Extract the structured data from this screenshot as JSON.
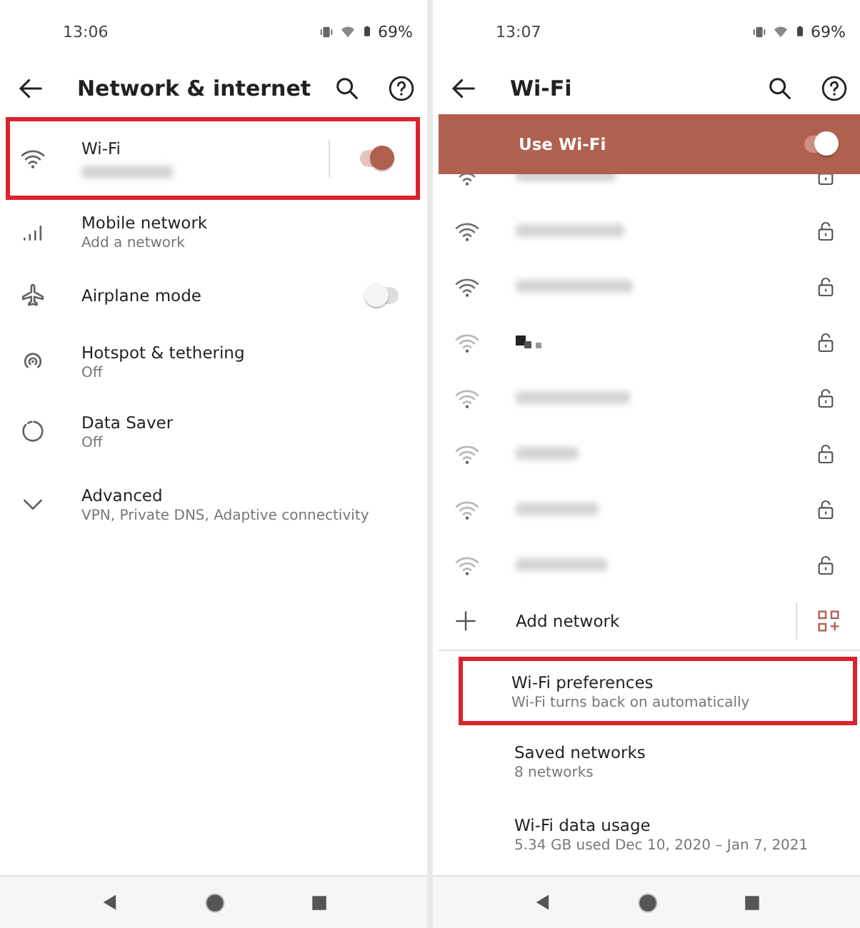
{
  "screens": [
    {
      "status_bar": {
        "time": "13:06",
        "battery": "69%"
      },
      "title": "Network & internet",
      "items": [
        {
          "kind": "toggle",
          "title": "Wi-Fi",
          "subtitle_redacted": true,
          "on": true,
          "highlighted": true
        },
        {
          "kind": "link",
          "title": "Mobile network",
          "subtitle": "Add a network",
          "highlighted": false
        },
        {
          "kind": "toggle",
          "title": "Airplane mode",
          "on": false,
          "highlighted": false
        },
        {
          "kind": "link",
          "title": "Hotspot & tethering",
          "subtitle": "Off",
          "highlighted": false
        },
        {
          "kind": "link",
          "title": "Data Saver",
          "subtitle": "Off",
          "highlighted": false
        },
        {
          "kind": "expand",
          "title": "Advanced",
          "subtitle": "VPN, Private DNS, Adaptive connectivity",
          "highlighted": false
        }
      ]
    },
    {
      "status_bar": {
        "time": "13:07",
        "battery": "69%"
      },
      "title": "Wi-Fi",
      "master_switch": {
        "label": "Use Wi-Fi",
        "on": true
      },
      "networks": [
        {
          "kind": "blurred",
          "locked": true
        },
        {
          "kind": "blurred",
          "locked": true
        },
        {
          "kind": "blurred",
          "locked": true
        },
        {
          "kind": "pixelated",
          "locked": true
        },
        {
          "kind": "blurred",
          "locked": true
        },
        {
          "kind": "blurred",
          "locked": true
        },
        {
          "kind": "blurred",
          "locked": true
        },
        {
          "kind": "blurred",
          "locked": true
        }
      ],
      "add_network": {
        "label": "Add network"
      },
      "items": [
        {
          "kind": "link",
          "title": "Wi-Fi preferences",
          "subtitle": "Wi-Fi turns back on automatically",
          "highlighted": true
        },
        {
          "kind": "link",
          "title": "Saved networks",
          "subtitle": "8 networks",
          "highlighted": false
        },
        {
          "kind": "link",
          "title": "Wi-Fi data usage",
          "subtitle": "5.34 GB used Dec 10, 2020 – Jan 7, 2021",
          "highlighted": false
        }
      ]
    }
  ]
}
